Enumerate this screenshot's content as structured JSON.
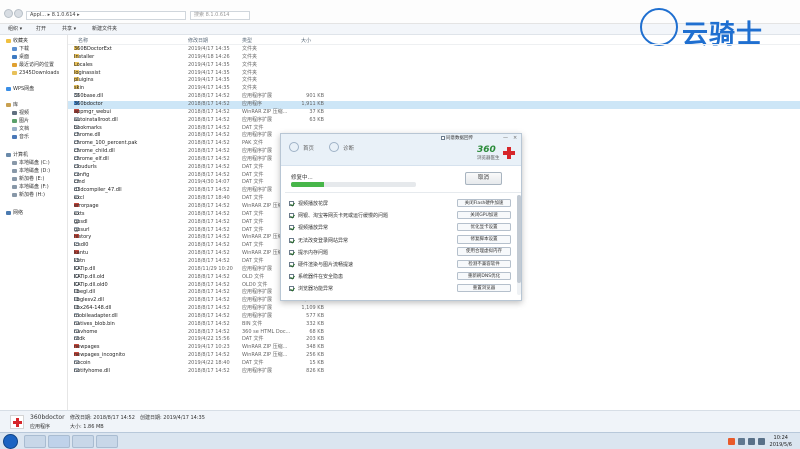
{
  "window": {
    "address": "AppI... ▸ 8.1.0.614 ▸",
    "search_placeholder": "搜索 8.1.0.614",
    "toolbar": [
      "组织 ▾",
      "打开",
      "共享 ▾",
      "新建文件夹"
    ]
  },
  "sidebar": {
    "items": [
      "收藏夹",
      "下载",
      "桌面",
      "最近访问的位置",
      "2345Downloads",
      "WPS网盘",
      "库",
      "视频",
      "图片",
      "文档",
      "音乐",
      "计算机",
      "本地磁盘 (C:)",
      "本地磁盘 (D:)",
      "新加卷 (E:)",
      "本地磁盘 (F:)",
      "新加卷 (H:)",
      "网络"
    ]
  },
  "filelist": {
    "columns": [
      "名称",
      "修改日期",
      "类型",
      "大小"
    ],
    "rows": [
      {
        "name": "360BDoctorExt",
        "date": "2019/4/17 14:35",
        "type": "文件夹",
        "size": "",
        "kind": "folder"
      },
      {
        "name": "Installer",
        "date": "2019/4/18 14:26",
        "type": "文件夹",
        "size": "",
        "kind": "folder"
      },
      {
        "name": "Locales",
        "date": "2019/4/17 14:35",
        "type": "文件夹",
        "size": "",
        "kind": "folder"
      },
      {
        "name": "loginassist",
        "date": "2019/4/17 14:35",
        "type": "文件夹",
        "size": "",
        "kind": "folder"
      },
      {
        "name": "pluigins",
        "date": "2019/4/17 14:35",
        "type": "文件夹",
        "size": "",
        "kind": "folder"
      },
      {
        "name": "skin",
        "date": "2019/4/17 14:35",
        "type": "文件夹",
        "size": "",
        "kind": "folder"
      },
      {
        "name": "360base.dll",
        "date": "2018/8/17 14:52",
        "type": "应用程序扩展",
        "size": "901 KB",
        "kind": "file"
      },
      {
        "name": "360bdoctor",
        "date": "2018/8/17 14:52",
        "type": "应用程序",
        "size": "1,911 KB",
        "kind": "app"
      },
      {
        "name": "appmgr_webui",
        "date": "2018/8/17 14:52",
        "type": "WinRAR ZIP 压缩...",
        "size": "37 KB",
        "kind": "zip"
      },
      {
        "name": "autoinstallroot.dll",
        "date": "2018/8/17 14:52",
        "type": "应用程序扩展",
        "size": "63 KB",
        "kind": "file"
      },
      {
        "name": "bookmarks",
        "date": "2018/8/17 14:52",
        "type": "DAT 文件",
        "size": "",
        "kind": "file"
      },
      {
        "name": "chrome.dll",
        "date": "2018/8/17 14:52",
        "type": "应用程序扩展",
        "size": "",
        "kind": "file"
      },
      {
        "name": "chrome_100_percent.pak",
        "date": "2018/8/17 14:52",
        "type": "PAK 文件",
        "size": "",
        "kind": "file"
      },
      {
        "name": "chrome_child.dll",
        "date": "2018/8/17 14:52",
        "type": "应用程序扩展",
        "size": "",
        "kind": "file"
      },
      {
        "name": "chrome_elf.dll",
        "date": "2018/8/17 14:52",
        "type": "应用程序扩展",
        "size": "",
        "kind": "file"
      },
      {
        "name": "cloudurls",
        "date": "2018/8/17 14:52",
        "type": "DAT 文件",
        "size": "",
        "kind": "file"
      },
      {
        "name": "config",
        "date": "2018/8/17 14:52",
        "type": "DAT 文件",
        "size": "",
        "kind": "file"
      },
      {
        "name": "cmd",
        "date": "2019/4/30 14:07",
        "type": "DAT 文件",
        "size": "",
        "kind": "file"
      },
      {
        "name": "d3dcompiler_47.dll",
        "date": "2018/8/17 14:52",
        "type": "应用程序扩展",
        "size": "",
        "kind": "file"
      },
      {
        "name": "excl",
        "date": "2018/8/17 18:40",
        "type": "DAT 文件",
        "size": "",
        "kind": "file"
      },
      {
        "name": "errorpage",
        "date": "2018/8/17 14:52",
        "type": "WinRAR ZIP 压缩...",
        "size": "",
        "kind": "zip"
      },
      {
        "name": "exts",
        "date": "2018/8/17 14:52",
        "type": "DAT 文件",
        "size": "",
        "kind": "file"
      },
      {
        "name": "gpsdl",
        "date": "2018/8/17 14:52",
        "type": "DAT 文件",
        "size": "",
        "kind": "file"
      },
      {
        "name": "gpsurl",
        "date": "2018/8/17 14:52",
        "type": "DAT 文件",
        "size": "",
        "kind": "file"
      },
      {
        "name": "history",
        "date": "2018/8/17 14:52",
        "type": "WinRAR ZIP 压缩...",
        "size": "",
        "kind": "zip"
      },
      {
        "name": "icsdl0",
        "date": "2018/8/17 14:52",
        "type": "DAT 文件",
        "size": "",
        "kind": "file"
      },
      {
        "name": "kantu",
        "date": "2018/8/17 14:52",
        "type": "WinRAR ZIP 压缩...",
        "size": "",
        "kind": "zip"
      },
      {
        "name": "kbtn",
        "date": "2018/8/17 14:52",
        "type": "DAT 文件",
        "size": "",
        "kind": "file"
      },
      {
        "name": "KATip.dll",
        "date": "2018/11/29 10:20",
        "type": "应用程序扩展",
        "size": "",
        "kind": "file"
      },
      {
        "name": "KATip.dll.old",
        "date": "2018/8/17 14:52",
        "type": "OLD 文件",
        "size": "477 KB",
        "kind": "file"
      },
      {
        "name": "KATip.dll.old0",
        "date": "2018/8/17 14:52",
        "type": "OLD0 文件",
        "size": "477 KB",
        "kind": "file"
      },
      {
        "name": "libegl.dll",
        "date": "2018/8/17 14:52",
        "type": "应用程序扩展",
        "size": "92 KB",
        "kind": "file"
      },
      {
        "name": "libglesv2.dll",
        "date": "2018/8/17 14:52",
        "type": "应用程序扩展",
        "size": "1,795 KB",
        "kind": "file"
      },
      {
        "name": "libx264-148.dll",
        "date": "2018/8/17 14:52",
        "type": "应用程序扩展",
        "size": "1,109 KB",
        "kind": "file"
      },
      {
        "name": "mobileadapter.dll",
        "date": "2018/8/17 14:52",
        "type": "应用程序扩展",
        "size": "577 KB",
        "kind": "file"
      },
      {
        "name": "natives_blob.bin",
        "date": "2018/8/17 14:52",
        "type": "BIN 文件",
        "size": "332 KB",
        "kind": "file"
      },
      {
        "name": "navhome",
        "date": "2018/8/17 14:52",
        "type": "360 se HTML Doc...",
        "size": "68 KB",
        "kind": "file"
      },
      {
        "name": "ntdk",
        "date": "2019/4/22 15:56",
        "type": "DAT 文件",
        "size": "203 KB",
        "kind": "file"
      },
      {
        "name": "newpages",
        "date": "2019/4/17 10:23",
        "type": "WinRAR ZIP 压缩...",
        "size": "348 KB",
        "kind": "zip"
      },
      {
        "name": "newpages_incognito",
        "date": "2018/8/17 14:52",
        "type": "WinRAR ZIP 压缩...",
        "size": "256 KB",
        "kind": "zip"
      },
      {
        "name": "nocoin",
        "date": "2019/4/22 18:40",
        "type": "DAT 文件",
        "size": "15 KB",
        "kind": "file"
      },
      {
        "name": "notifyhome.dll",
        "date": "2018/8/17 14:52",
        "type": "应用程序扩展",
        "size": "826 KB",
        "kind": "file"
      }
    ]
  },
  "details": {
    "name": "360bdoctor",
    "modified_label": "修改日期: 2018/8/17 14:52",
    "created_label": "创建日期: 2019/4/17 14:35",
    "type": "应用程序",
    "size_label": "大小: 1.86 MB"
  },
  "popup": {
    "check_label": "同意数据回传",
    "ctrl_min": "—",
    "ctrl_close": "×",
    "tab1": "首页",
    "tab2": "诊断",
    "brand": "360",
    "brand_sub": "浏览器医生",
    "status": "修复中...",
    "progress": 0.26,
    "cancel": "取消",
    "items": [
      {
        "label": "视频播放花屏",
        "button": "关闭Flash硬件加速"
      },
      {
        "label": "网银、淘宝等网页卡死或运行缓慢的问题",
        "button": "关闭GPU加速"
      },
      {
        "label": "视频播放异常",
        "button": "优化显卡设置"
      },
      {
        "label": "无法改变登录网站异常",
        "button": "修复脚本设置"
      },
      {
        "label": "提示内存问题",
        "button": "使用合理虚拟内存"
      },
      {
        "label": "硬件渲染与图片流畅提速",
        "button": "检测不兼容软件"
      },
      {
        "label": "系统器件在安全隐患",
        "button": "重新刷DNS优化"
      },
      {
        "label": "浏览器功能异常",
        "button": "重置浏览器"
      }
    ]
  },
  "watermark": {
    "text": "云骑士"
  },
  "taskbar": {
    "time": "10:24",
    "date": "2019/5/6"
  }
}
